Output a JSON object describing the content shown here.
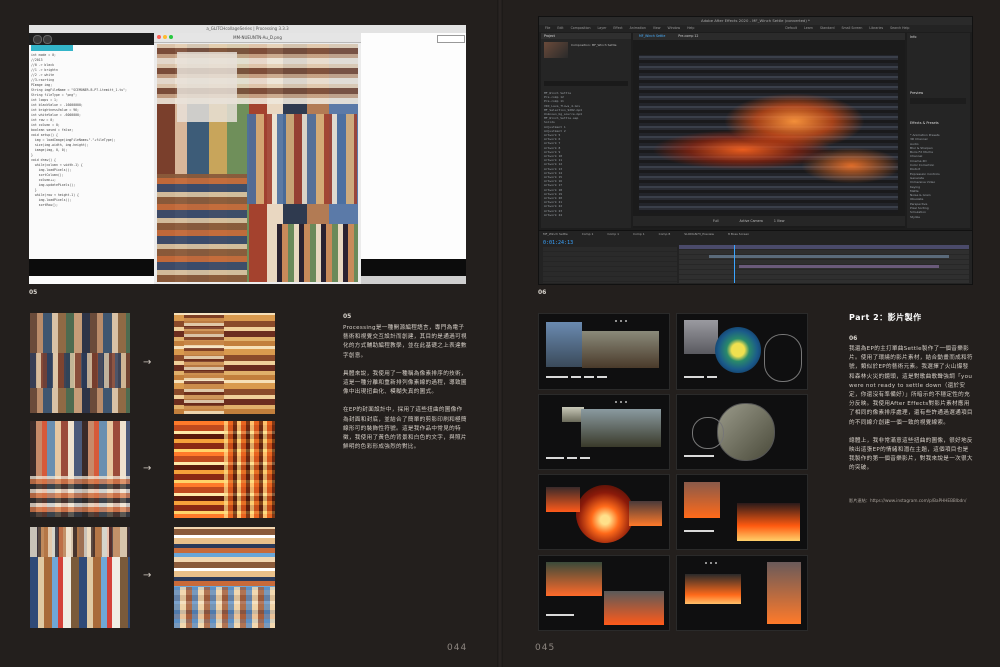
{
  "left_page": {
    "screenshot": {
      "title_bar": "a_GLITCHcollageSeries | Processing 3.3.3",
      "image_window_title": "MM-NUEUNTN-Au_D.png",
      "code_lines": [
        "int mode = 0;",
        "",
        "//2013",
        "//0 -> black",
        "//1 -> brightn",
        "//2 -> white",
        "//3->sorting",
        "",
        "PImage img;",
        "String imgFileName = \"SCEMONER-B-P7-Ltemitt_1.tu\";",
        "String fileType = \"png\";",
        "",
        "int loops = 1;",
        "",
        "int blackValue = -16000000;",
        "int brightnessValue = 96;",
        "int whiteValue = -6000000;",
        "",
        "int row = 0;",
        "int column = 0;",
        "",
        "boolean saved = false;",
        "",
        "void setup() {",
        "  img = loadImage(imgFileName+\".\"+fileType);",
        "  size(img.width, img.height);",
        "  image(img, 0, 0);",
        "}",
        "",
        "void draw() {",
        "  while(column < width-1) {",
        "    img.loadPixels();",
        "    sortColumn();",
        "    column++;",
        "    img.updatePixels();",
        "  }",
        "",
        "  while(row < height-1) {",
        "    img.loadPixels();",
        "    sortRow();"
      ]
    },
    "fig_number_top": "05",
    "section_number": "05",
    "paragraphs": [
      "Processing是一種開源編程語言，專門為電子藝術和視覺交互設計而創建，其目的是通過可視化的方式輔助編程教學，並在此基礎之上表達數字創意。",
      "具體來說，我使用了一種稱為像素排序的技術，這是一種分離和重新排列像素線的過程，導致圖像中出現扭曲化、模糊失真的圖式。",
      "在EP的封面設計中，採用了這些扭曲的圖像作為封面和封底，並結合了簡單的剪影印刷和極簡線形可的裝飾性符號。這是我作品中常見的特徵，我使用了黃色的背景和白色的文字，與照片鮮明的色彩形成強烈的對比。"
    ],
    "arrow_glyph": "→",
    "folio": "044"
  },
  "right_page": {
    "screenshot": {
      "title_bar": "Adobe After Effects 2020 - MF_Winch Settle (converted) *",
      "menu_items": [
        "File",
        "Edit",
        "Composition",
        "Layer",
        "Effect",
        "Animation",
        "View",
        "Window",
        "Help"
      ],
      "workspace_tabs": [
        "Default",
        "Learn",
        "Standard",
        "Small Screen",
        "Libraries"
      ],
      "search_label": "Search Help",
      "project_tab": "Project",
      "project_header": "Composition: MF_Winch Settle",
      "comp_tab": "MF_Winch Settle",
      "comp_subtab": "Pre-comp 12",
      "project_items": [
        "MF_Winch Settle",
        "Pre-comp 12",
        "Pre-comp 11",
        "VID_Lava_flows_4.mov",
        "MF_Selection_9282.mp4",
        "Unknown_bg_source.mp4",
        "MF_Winch_Settle.aep",
        "Solids",
        "Adjustment 1",
        "Adjustment 2",
        "Artwork 5",
        "Artwork 6",
        "Artwork 7",
        "Artwork 8",
        "Artwork 9",
        "Artwork 10",
        "Artwork 11",
        "Artwork 12",
        "Artwork 13",
        "Artwork 14",
        "Artwork 15",
        "Artwork 16",
        "Artwork 17",
        "Artwork 18",
        "Artwork 19",
        "Artwork 20",
        "Artwork 21",
        "Artwork 22",
        "Artwork 23",
        "Artwork 24"
      ],
      "info_tab": "Info",
      "preview_tab": "Preview",
      "effects_tab": "Effects & Presets",
      "effects_items": [
        "* Animation Presets",
        "3D Channel",
        "Audio",
        "Blur & Sharpen",
        "Boris FX Mocha",
        "Channel",
        "Cinema 4D",
        "Color Correction",
        "Distort",
        "Expression Controls",
        "Generate",
        "Immersive Video",
        "Keying",
        "Matte",
        "Noise & Grain",
        "Obsolete",
        "Perspective",
        "Pixel Sorting",
        "Simulation",
        "Stylize"
      ],
      "timecode": "0:01:24:13",
      "timeline_tabs": [
        "MF_Winch Settle",
        "Comp 1",
        "Comp 1",
        "Comp 1",
        "Comp 8",
        "SLODGN73_Preview",
        "8 Boss Screen"
      ],
      "zoom": "Full",
      "active_camera": "Active Camera",
      "view": "1 View"
    },
    "fig_number_top": "06",
    "part_heading": "Part 2：影片製作",
    "section_number": "06",
    "paragraphs": [
      "我還為EP的主打單曲Settle製作了一個音樂影片。使用了環繞的影片素材，結合動畫而成和符號，類似於EP的藝術元素。我選擇了火山爆發和森林火災的鏡頭，這是對歌曲歌聲強調「you were not ready to settle down（還於安定，你還沒有準備好）」所暗示的不穩定性的充分反映。我使用After Effects對影片素材應用了相同的像素排序處理，還有些許通過選通項目的不同線介創建一個一致的視覺線索。",
      "總體上，我非常滿意這些扭曲的圖像，很好地反映出這張EP的情緒和潛在主題，這個項目也是我製作的第一個音樂影片，對我來說是一次很大的突破。"
    ],
    "credit": "影片連結：https://www.instagram.com/p/BaPHHEBBlbdn/",
    "folio": "045"
  }
}
